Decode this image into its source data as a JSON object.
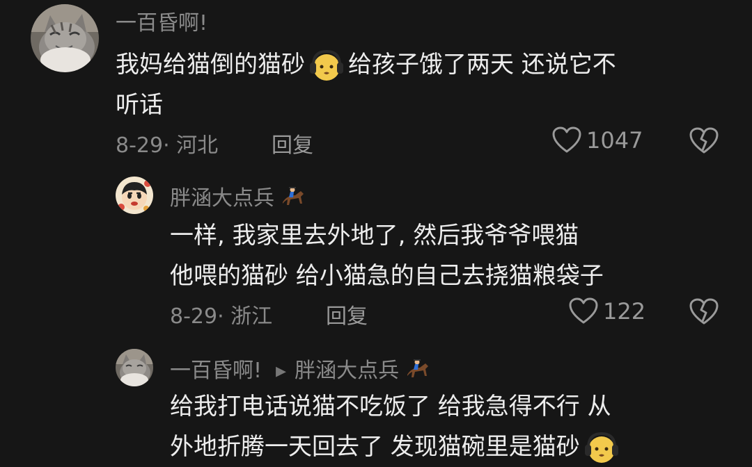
{
  "comments": [
    {
      "username": "一百昏啊!",
      "lines": [
        "我妈给猫倒的猫砂",
        "给孩子饿了两天 还说它不",
        "听话"
      ],
      "inline_emoji": "earphone-face-emoji",
      "date_location": "8-29· 河北",
      "reply_label": "回复",
      "like_count": "1047",
      "avatar": "cat-avatar"
    },
    {
      "username": "胖涵大点兵",
      "username_icon": "horse-rider-icon",
      "lines": [
        "一样, 我家里去外地了, 然后我爷爷喂猫",
        "他喂的猫砂 给小猫急的自己去挠猫粮袋子"
      ],
      "date_location": "8-29· 浙江",
      "reply_label": "回复",
      "like_count": "122",
      "avatar": "cartoon-avatar"
    },
    {
      "username": "一百昏啊!",
      "reply_to": "胖涵大点兵",
      "reply_to_icon": "horse-rider-icon",
      "lines": [
        "给我打电话说猫不吃饭了 给我急得不行 从",
        "外地折腾一天回去了 发现猫碗里是猫砂"
      ],
      "inline_emoji": "earphone-face-emoji",
      "avatar": "cat-avatar"
    }
  ],
  "colors": {
    "background": "#161616",
    "text": "#ededed",
    "muted": "#8a8a8a",
    "emoji_yellow": "#f2c94c"
  }
}
